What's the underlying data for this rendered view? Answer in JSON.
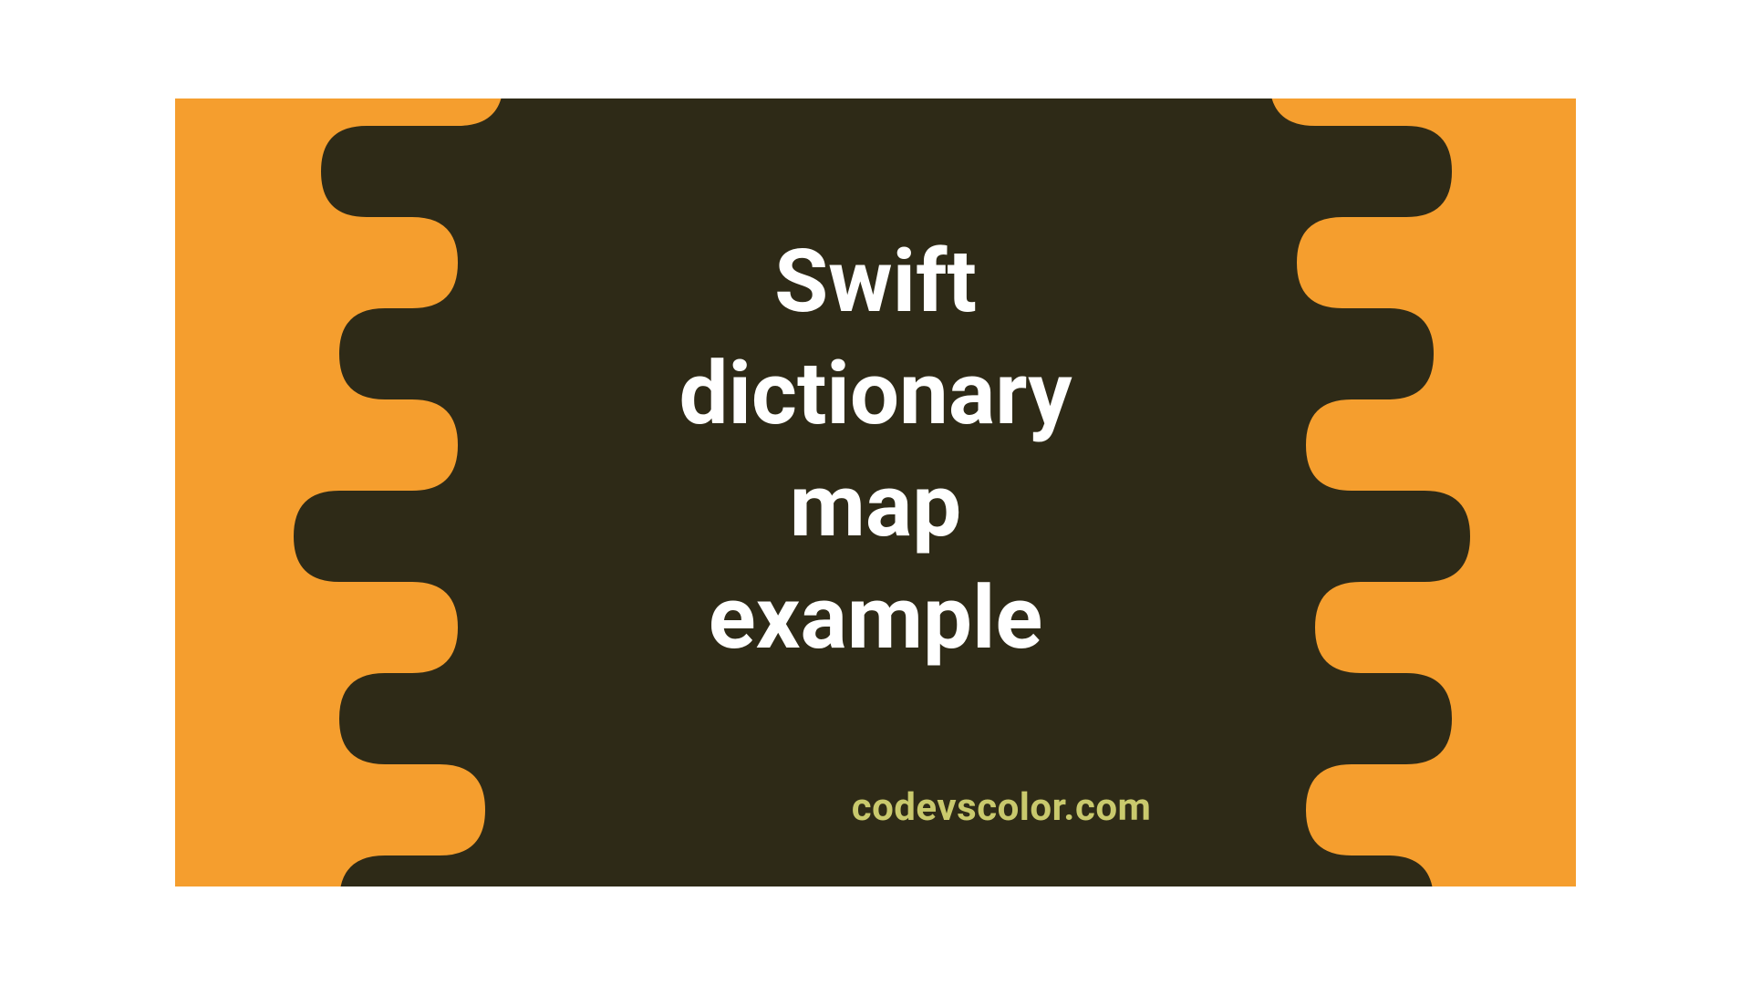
{
  "title_lines": "Swift\ndictionary\nmap\nexample",
  "footer": "codevscolor.com",
  "colors": {
    "background": "#f59e2e",
    "blob": "#2e2a17",
    "title": "#ffffff",
    "footer": "#c9c96d"
  }
}
